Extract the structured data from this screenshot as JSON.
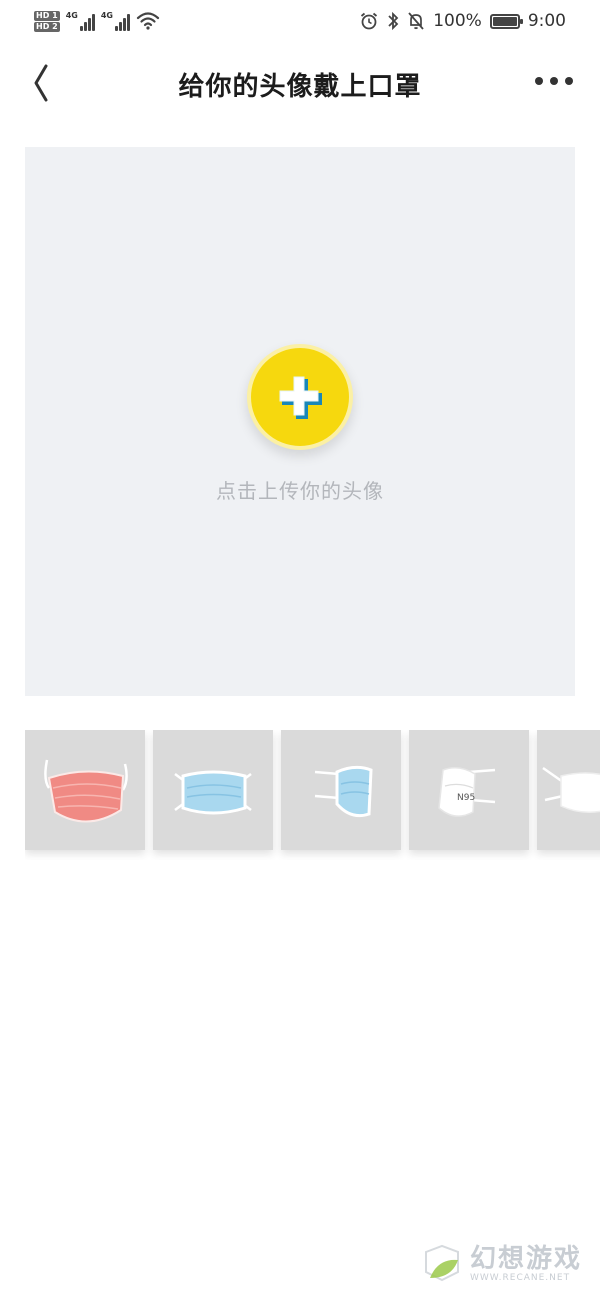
{
  "status_bar": {
    "sim1_label": "HD 1",
    "sim2_label": "HD 2",
    "net1_label": "4G",
    "net2_label": "4G",
    "battery_percent": "100%",
    "battery_level": 1.0,
    "time": "9:00"
  },
  "nav": {
    "title": "给你的头像戴上口罩"
  },
  "upload": {
    "hint": "点击上传你的头像"
  },
  "masks": [
    {
      "name": "pink-surgical-mask",
      "color": "#f08a84"
    },
    {
      "name": "blue-surgical-mask",
      "color": "#a9d8ef"
    },
    {
      "name": "blue-side-mask",
      "color": "#a9d8ef"
    },
    {
      "name": "n95-mask",
      "color": "#ffffff",
      "label": "N95"
    },
    {
      "name": "white-mask",
      "color": "#ffffff"
    }
  ],
  "watermark": {
    "title": "幻想游戏",
    "url": "WWW.RECANE.NET"
  },
  "colors": {
    "plus_button": "#f6d80e",
    "upload_bg": "#eff1f4",
    "tile_bg": "#dadada"
  }
}
